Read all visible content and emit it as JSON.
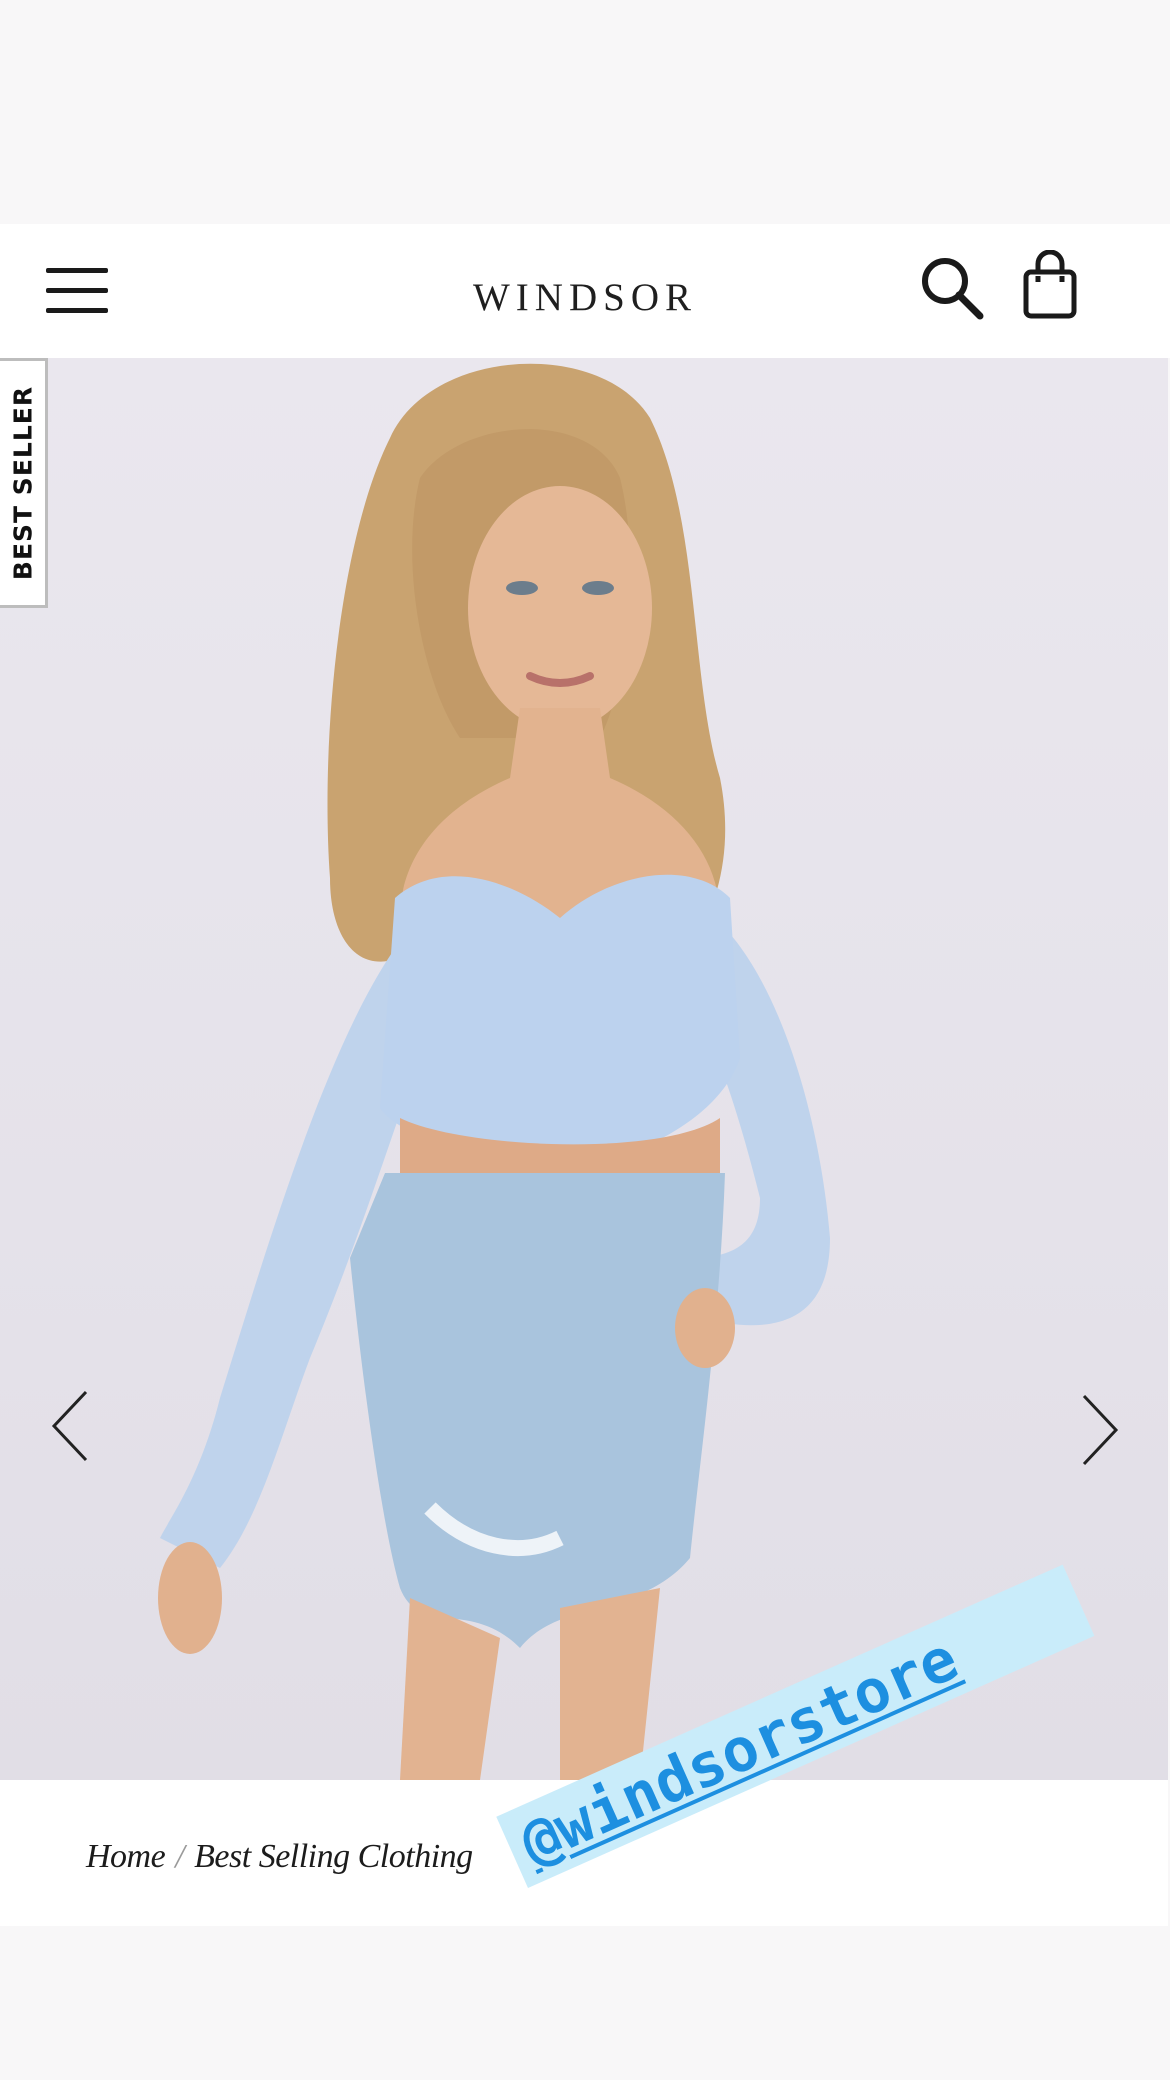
{
  "header": {
    "brand": "WINDSOR",
    "menu_icon": "hamburger-menu-icon",
    "search_icon": "search-icon",
    "bag_icon": "shopping-bag-icon"
  },
  "product_image": {
    "badge": "BEST SELLER",
    "prev_icon": "chevron-left-icon",
    "next_icon": "chevron-right-icon",
    "background_color": "#e6e3ea"
  },
  "breadcrumb": {
    "items": [
      "Home",
      "Best Selling Clothing"
    ],
    "separator": "/"
  },
  "overlay_tag": {
    "text": "@windsorstore",
    "text_color": "#1d8fe0",
    "background_color": "#c9ecfa"
  }
}
